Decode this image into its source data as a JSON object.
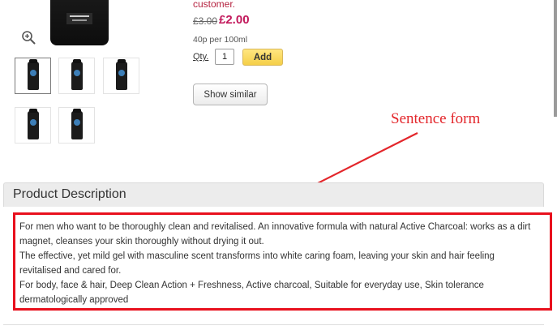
{
  "product": {
    "customer_text": "customer.",
    "old_price": "£3.00",
    "new_price": "£2.00",
    "unit_price": "40p per 100ml",
    "qty_label": "Qty.",
    "qty_value": "1",
    "add_label": "Add",
    "show_similar_label": "Show similar",
    "thumbnails_count": 5
  },
  "annotation": {
    "text": "Sentence form",
    "color": "#e3262b"
  },
  "description": {
    "title": "Product Description",
    "paragraphs": [
      "For men who want to be thoroughly clean and revitalised. An innovative formula with natural Active Charcoal: works as a dirt magnet, cleanses your skin thoroughly without drying it out.",
      "The effective, yet mild gel with masculine scent transforms into white caring foam, leaving your skin and hair feeling revitalised and cared for.",
      "For body, face & hair, Deep Clean Action + Freshness, Active charcoal, Suitable for everyday use, Skin tolerance dermatologically approved"
    ]
  },
  "colors": {
    "price_accent": "#c2185b",
    "add_button": "#f5cf48",
    "highlight_box": "#e8101d"
  },
  "icons": {
    "zoom": "zoom-in-icon",
    "arrow": "annotation-arrow-icon"
  }
}
